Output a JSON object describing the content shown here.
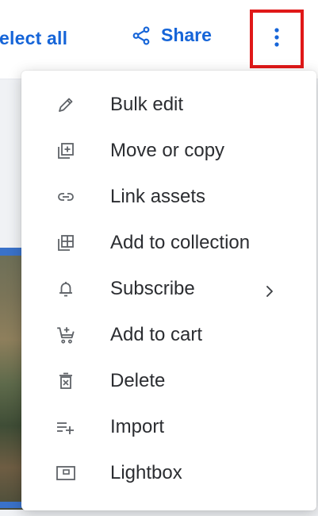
{
  "toolbar": {
    "select_all_label": "elect all",
    "share_label": "Share",
    "more_icon": "kebab-vertical-icon",
    "accent_color": "#1665d8",
    "highlight_color": "#e01818"
  },
  "menu": {
    "items": [
      {
        "label": "Bulk edit",
        "icon": "pencil-icon"
      },
      {
        "label": "Move or copy",
        "icon": "move-copy-icon"
      },
      {
        "label": "Link assets",
        "icon": "link-icon"
      },
      {
        "label": "Add to collection",
        "icon": "add-collection-icon"
      },
      {
        "label": "Subscribe",
        "icon": "bell-icon",
        "submenu_icon": "chevron-right-icon"
      },
      {
        "label": "Add to cart",
        "icon": "cart-add-icon"
      },
      {
        "label": "Delete",
        "icon": "trash-icon"
      },
      {
        "label": "Import",
        "icon": "import-list-icon"
      },
      {
        "label": "Lightbox",
        "icon": "lightbox-icon"
      }
    ]
  }
}
